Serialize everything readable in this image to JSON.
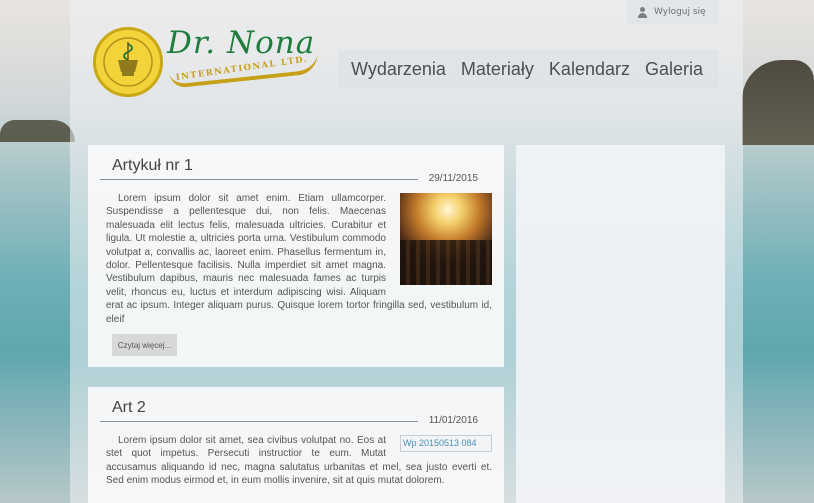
{
  "header": {
    "logout_label": "Wyloguj się",
    "brand_name": "Dr. Nona",
    "brand_subtitle": "INTERNATIONAL LTD.",
    "nav": [
      "Wydarzenia",
      "Materiały",
      "Kalendarz",
      "Galeria"
    ]
  },
  "articles": [
    {
      "title": "Artykuł nr 1",
      "date": "29/11/2015",
      "body": "Lorem ipsum dolor sit amet enim. Etiam ullamcorper. Suspendisse a pellentesque dui, non felis. Maecenas malesuada elit lectus felis, malesuada ultricies. Curabitur et ligula. Ut molestie a, ultricies porta urna. Vestibulum commodo volutpat a, convallis ac, laoreet enim. Phasellus fermentum in, dolor. Pellentesque facilisis. Nulla imperdiet sit amet magna. Vestibulum dapibus, mauris nec malesuada fames ac turpis velit, rhoncus eu, luctus et interdum adipiscing wisi. Aliquam erat ac ipsum. Integer aliquam purus. Quisque lorem tortor fringilla sed, vestibulum id, eleif",
      "read_more": "Czytaj więcej..."
    },
    {
      "title": "Art 2",
      "date": "11/01/2016",
      "image_alt": "Wp 20150513 084",
      "body": "Lorem ipsum dolor sit amet, sea civibus volutpat no. Eos at stet quot impetus. Persecuti instructior te eum. Mutat accusamus aliquando id nec, magna salutatus urbanitas et mel, sea justo everti et. Sed enim modus eirmod et, in eum mollis invenire, sit at quis mutat dolorem."
    }
  ],
  "colors": {
    "brand_green": "#1f7e3e",
    "brand_gold": "#c6a019",
    "nav_text": "#4a4f53"
  }
}
